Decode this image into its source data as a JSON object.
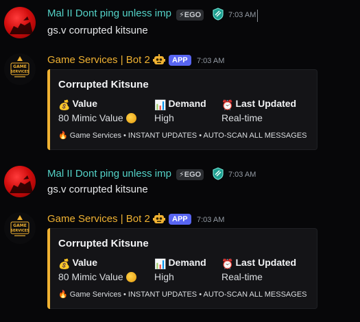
{
  "messages": [
    {
      "type": "user",
      "author": "Mal II Dont ping unless imp",
      "badge": "EGO",
      "time": "7:03 AM",
      "text": "gs.v corrupted kitsune"
    },
    {
      "type": "bot",
      "author": "Game Services | Bot 2",
      "badge": "APP",
      "time": "7:03 AM",
      "embed": {
        "title": "Corrupted Kitsune",
        "fields": [
          {
            "icon": "money-bag-icon",
            "glyph": "💰",
            "name": "Value",
            "value": "80 Mimic Value"
          },
          {
            "icon": "chart-icon",
            "glyph": "📊",
            "name": "Demand",
            "value": "High"
          },
          {
            "icon": "alarm-clock-icon",
            "glyph": "⏰",
            "name": "Last Updated",
            "value": "Real-time"
          }
        ],
        "footer": "🔥 Game Services • INSTANT UPDATES • AUTO-SCAN ALL MESSAGES"
      }
    },
    {
      "type": "user",
      "author": "Mal II Dont ping unless imp",
      "badge": "EGO",
      "time": "7:03 AM",
      "text": "gs.v corrupted kitsune"
    },
    {
      "type": "bot",
      "author": "Game Services | Bot 2",
      "badge": "APP",
      "time": "7:03 AM",
      "embed": {
        "title": "Corrupted Kitsune",
        "fields": [
          {
            "icon": "money-bag-icon",
            "glyph": "💰",
            "name": "Value",
            "value": "80 Mimic Value"
          },
          {
            "icon": "chart-icon",
            "glyph": "📊",
            "name": "Demand",
            "value": "High"
          },
          {
            "icon": "alarm-clock-icon",
            "glyph": "⏰",
            "name": "Last Updated",
            "value": "Real-time"
          }
        ],
        "footer": "🔥 Game Services • INSTANT UPDATES • AUTO-SCAN ALL MESSAGES"
      }
    }
  ],
  "colors": {
    "background": "#070709",
    "user_name": "#54d3c8",
    "bot_name": "#f0b232",
    "embed_accent": "#f0b232",
    "app_badge": "#5865f2"
  },
  "logo_text": "GAME SERVICES"
}
